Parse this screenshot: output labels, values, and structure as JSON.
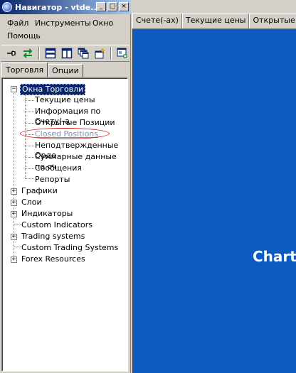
{
  "window": {
    "title": "Навигатор - vtde...",
    "controls": {
      "minimize": "_",
      "maximize": "□",
      "close": "×"
    }
  },
  "menu": {
    "items": [
      "Файл",
      "Инструменты",
      "Окно",
      "Помощь"
    ]
  },
  "toolbar": {
    "icons": [
      "pin-icon",
      "swap-arrows-icon",
      "tile-horizontal-icon",
      "tile-vertical-icon",
      "cascade-windows-icon",
      "new-window-icon",
      "window-settings-icon"
    ]
  },
  "tabs": [
    "Торговля",
    "Опции"
  ],
  "tree": {
    "root": {
      "label": "Окна Торговли",
      "expander": "−",
      "children": [
        "Текущие цены",
        "Информация по Счету(-а",
        "Открытые Позиции",
        "Closed Positions",
        "Неподтвержденные Орде",
        "Суммарные данные по сч",
        "Сообщения",
        "Репорты"
      ]
    },
    "groups": [
      {
        "label": "Графики",
        "expander": "+"
      },
      {
        "label": "Слои",
        "expander": "+"
      },
      {
        "label": "Индикаторы",
        "expander": "+"
      },
      {
        "label": "Custom Indicators",
        "expander": ""
      },
      {
        "label": "Trading systems",
        "expander": "+"
      },
      {
        "label": "Custom Trading Systems",
        "expander": ""
      },
      {
        "label": "Forex Resources",
        "expander": "+"
      }
    ]
  },
  "right_tabs": [
    "Счете(-ах)",
    "Текущие цены",
    "Открытые по"
  ],
  "chart_area": {
    "label": "Chart",
    "background": "#0d5ac0"
  },
  "colors": {
    "title_bar": "#0a246a",
    "selection": "#0a246a",
    "highlight_ellipse": "#d01818"
  }
}
